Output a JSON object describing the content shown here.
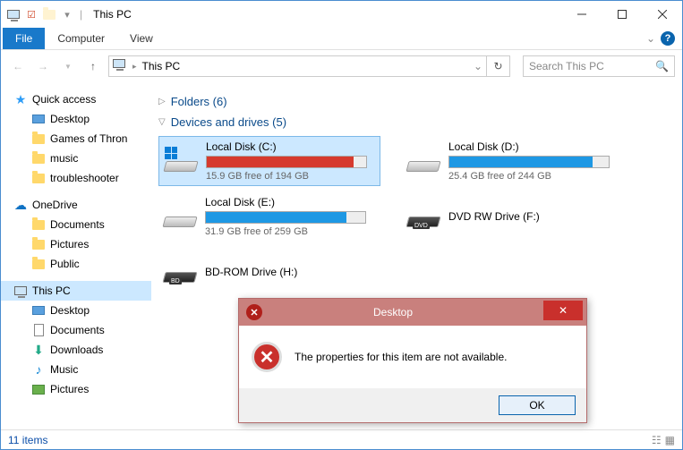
{
  "window": {
    "title": "This PC"
  },
  "ribbon": {
    "file": "File",
    "computer": "Computer",
    "view": "View"
  },
  "nav": {
    "address": "This PC",
    "search_placeholder": "Search This PC"
  },
  "sidebar": {
    "quick_access": "Quick access",
    "qa_items": [
      "Desktop",
      "Games of Thron",
      "music",
      "troubleshooter"
    ],
    "onedrive": "OneDrive",
    "od_items": [
      "Documents",
      "Pictures",
      "Public"
    ],
    "this_pc": "This PC",
    "pc_items": [
      "Desktop",
      "Documents",
      "Downloads",
      "Music",
      "Pictures"
    ]
  },
  "groups": {
    "folders": "Folders (6)",
    "devices": "Devices and drives (5)"
  },
  "drives": [
    {
      "name": "Local Disk (C:)",
      "free": "15.9 GB free of 194 GB",
      "bar": true,
      "pct": 92,
      "color": "red",
      "selected": true,
      "kind": "win"
    },
    {
      "name": "Local Disk (D:)",
      "free": "25.4 GB free of 244 GB",
      "bar": true,
      "pct": 90,
      "color": "blue",
      "selected": false,
      "kind": "hdd"
    },
    {
      "name": "Local Disk (E:)",
      "free": "31.9 GB free of 259 GB",
      "bar": true,
      "pct": 88,
      "color": "blue",
      "selected": false,
      "kind": "hdd"
    },
    {
      "name": "DVD RW Drive (F:)",
      "free": "",
      "bar": false,
      "pct": 0,
      "color": "",
      "selected": false,
      "kind": "dvd"
    },
    {
      "name": "BD-ROM Drive (H:)",
      "free": "",
      "bar": false,
      "pct": 0,
      "color": "",
      "selected": false,
      "kind": "bd"
    }
  ],
  "statusbar": {
    "items": "11 items"
  },
  "dialog": {
    "title": "Desktop",
    "message": "The properties for this item are not available.",
    "ok": "OK"
  }
}
